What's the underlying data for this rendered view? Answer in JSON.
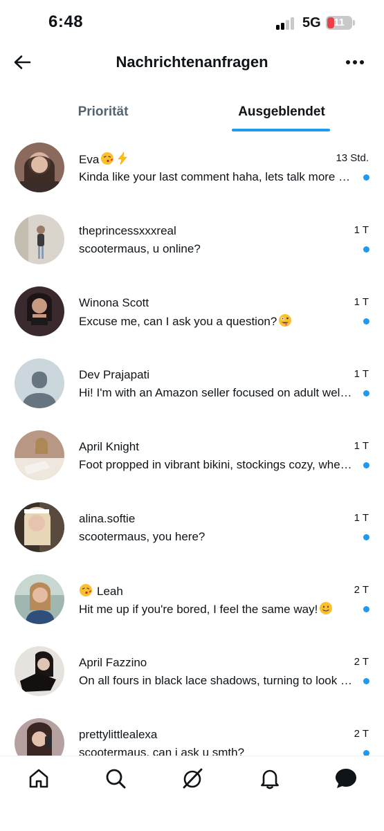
{
  "status_bar": {
    "time": "6:48",
    "network": "5G",
    "battery": "11"
  },
  "header": {
    "title": "Nachrichtenanfragen"
  },
  "tabs": [
    {
      "label": "Priorität",
      "active": false
    },
    {
      "label": "Ausgeblendet",
      "active": true
    }
  ],
  "accent_color": "#1d9bf0",
  "conversations": [
    {
      "name": "Eva",
      "name_emojis": [
        "kiss-emoji",
        "lightning-emoji"
      ],
      "time": "13 Std.",
      "preview": "Kinda like your last comment haha, lets talk more about it",
      "unread": true
    },
    {
      "name": "theprincessxxxreal",
      "time": "1 T",
      "preview": "scootermaus, u online?",
      "unread": true
    },
    {
      "name": "Winona Scott",
      "time": "1 T",
      "preview": "Excuse me, can I ask you a question?",
      "preview_emoji": "zany-face-emoji",
      "unread": true
    },
    {
      "name": "Dev Prajapati",
      "time": "1 T",
      "preview": "Hi! I'm with an Amazon seller focused on adult wellness",
      "unread": true
    },
    {
      "name": "April Knight",
      "time": "1 T",
      "preview": "Foot propped in vibrant bikini, stockings cozy, wherever",
      "unread": true
    },
    {
      "name": "alina.softie",
      "time": "1 T",
      "preview": "scootermaus, you here?",
      "unread": true
    },
    {
      "name": "Leah",
      "name_prefix_emoji": "kiss-emoji",
      "time": "2 T",
      "preview": "Hit me up if you're bored, I feel the same way!",
      "preview_emoji": "smile-emoji",
      "unread": true
    },
    {
      "name": "April Fazzino",
      "time": "2 T",
      "preview": "On all fours in black lace shadows, turning to look back",
      "unread": true
    },
    {
      "name": "prettylittlealexa",
      "time": "2 T",
      "preview": "scootermaus, can i ask u smth?",
      "unread": true
    }
  ],
  "bottom_nav": [
    "home-icon",
    "search-icon",
    "grok-icon",
    "notifications-icon",
    "messages-icon"
  ]
}
